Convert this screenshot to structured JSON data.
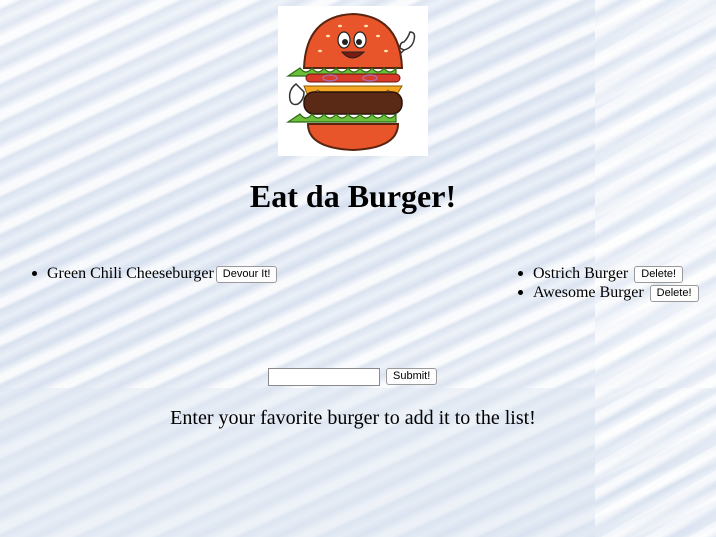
{
  "header": {
    "logo_icon": "smiling-burger-thumbs-up-icon",
    "title": "Eat da Burger!"
  },
  "uneaten": {
    "items": [
      {
        "name": "Green Chili Cheeseburger",
        "button": "Devour It!"
      }
    ]
  },
  "devoured": {
    "items": [
      {
        "name": "Ostrich Burger",
        "button": "Delete!"
      },
      {
        "name": "Awesome Burger",
        "button": "Delete!"
      }
    ]
  },
  "form": {
    "input_value": "",
    "input_placeholder": "",
    "submit_label": "Submit!",
    "hint": "Enter your favorite burger to add it to the list!"
  }
}
